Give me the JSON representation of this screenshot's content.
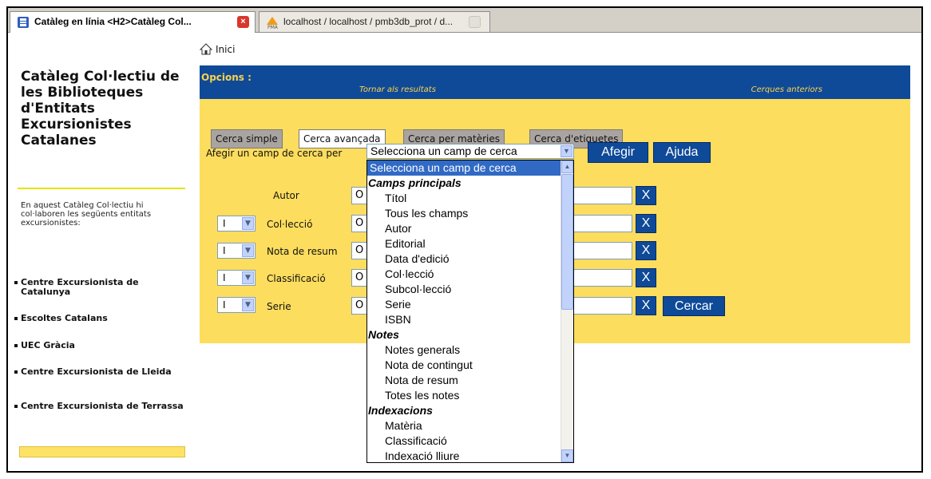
{
  "browser": {
    "tabs": [
      {
        "title": "Catàleg en línia <H2>Catàleg Col...",
        "active": true,
        "icon": "b-logo-icon"
      },
      {
        "title": "localhost / localhost / pmb3db_prot / d...",
        "active": false,
        "icon": "pma-icon"
      }
    ]
  },
  "sidebar": {
    "title": "Catàleg Col·lectiu de les Biblioteques d'Entitats Excursionistes Catalanes",
    "description": "En aquest Catàleg Col·lectiu hi col·laboren les següents entitats excursionistes:",
    "entities": [
      "Centre Excursionista de Catalunya",
      "Escoltes Catalans",
      "UEC Gràcia",
      "Centre Excursionista de Lleida",
      "Centre Excursionista de Terrassa"
    ]
  },
  "home": {
    "label": "Inici"
  },
  "options": {
    "label": "Opcions :",
    "back": "Tornar als resultats",
    "previous": "Cerques anteriors"
  },
  "search_tabs": [
    "Cerca simple",
    "Cerca avançada",
    "Cerca per matèries",
    "Cerca d'etiquetes"
  ],
  "add_field": {
    "label": "Afegir un camp de cerca per",
    "selected": "Selecciona un camp de cerca",
    "add_button": "Afegir",
    "help_button": "Ajuda"
  },
  "criteria": [
    {
      "label": "Autor",
      "operator": "",
      "value": "O"
    },
    {
      "label": "Col·lecció",
      "operator": "I",
      "value": "O"
    },
    {
      "label": "Nota de resum",
      "operator": "I",
      "value": "O"
    },
    {
      "label": "Classificació",
      "operator": "I",
      "value": "O"
    },
    {
      "label": "Serie",
      "operator": "I",
      "value": "O"
    }
  ],
  "remove_label": "X",
  "search_button": "Cercar",
  "dropdown": {
    "highlighted": "Selecciona un camp de cerca",
    "groups": [
      {
        "name": "Camps principals",
        "options": [
          "Títol",
          "Tous les champs",
          "Autor",
          "Editorial",
          "Data d'edició",
          "Col·lecció",
          "Subcol·lecció",
          "Serie",
          "ISBN"
        ]
      },
      {
        "name": "Notes",
        "options": [
          "Notes generals",
          "Nota de contingut",
          "Nota de resum",
          "Totes les notes"
        ]
      },
      {
        "name": "Indexacions",
        "options": [
          "Matèria",
          "Classificació",
          "Indexació lliure"
        ]
      }
    ]
  },
  "colors": {
    "navy": "#0f4a98",
    "yellow": "#fddd5e",
    "highlight": "#316ac5"
  }
}
